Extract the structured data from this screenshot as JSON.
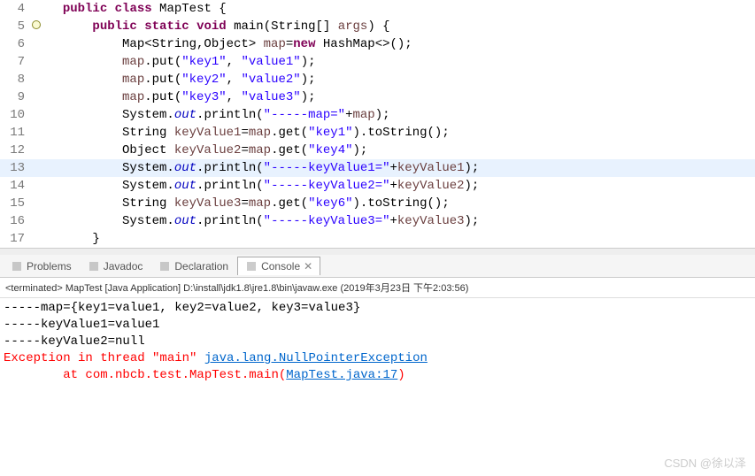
{
  "editor": {
    "lines": [
      {
        "num": 4,
        "marker": "",
        "highlight": false,
        "tokens": [
          {
            "cls": "norm",
            "t": "  "
          },
          {
            "cls": "kw",
            "t": "public"
          },
          {
            "cls": "norm",
            "t": " "
          },
          {
            "cls": "kw",
            "t": "class"
          },
          {
            "cls": "norm",
            "t": " MapTest {"
          }
        ]
      },
      {
        "num": 5,
        "marker": "circ",
        "highlight": false,
        "tokens": [
          {
            "cls": "norm",
            "t": "      "
          },
          {
            "cls": "kw",
            "t": "public"
          },
          {
            "cls": "norm",
            "t": " "
          },
          {
            "cls": "kw",
            "t": "static"
          },
          {
            "cls": "norm",
            "t": " "
          },
          {
            "cls": "kw",
            "t": "void"
          },
          {
            "cls": "norm",
            "t": " main(String[] "
          },
          {
            "cls": "var",
            "t": "args"
          },
          {
            "cls": "norm",
            "t": ") {"
          }
        ]
      },
      {
        "num": 6,
        "marker": "",
        "highlight": false,
        "tokens": [
          {
            "cls": "norm",
            "t": "          Map<String,Object> "
          },
          {
            "cls": "var",
            "t": "map"
          },
          {
            "cls": "norm",
            "t": "="
          },
          {
            "cls": "kw",
            "t": "new"
          },
          {
            "cls": "norm",
            "t": " HashMap<>();"
          }
        ]
      },
      {
        "num": 7,
        "marker": "",
        "highlight": false,
        "tokens": [
          {
            "cls": "norm",
            "t": "          "
          },
          {
            "cls": "var",
            "t": "map"
          },
          {
            "cls": "norm",
            "t": ".put("
          },
          {
            "cls": "str",
            "t": "\"key1\""
          },
          {
            "cls": "norm",
            "t": ", "
          },
          {
            "cls": "str",
            "t": "\"value1\""
          },
          {
            "cls": "norm",
            "t": ");"
          }
        ]
      },
      {
        "num": 8,
        "marker": "",
        "highlight": false,
        "tokens": [
          {
            "cls": "norm",
            "t": "          "
          },
          {
            "cls": "var",
            "t": "map"
          },
          {
            "cls": "norm",
            "t": ".put("
          },
          {
            "cls": "str",
            "t": "\"key2\""
          },
          {
            "cls": "norm",
            "t": ", "
          },
          {
            "cls": "str",
            "t": "\"value2\""
          },
          {
            "cls": "norm",
            "t": ");"
          }
        ]
      },
      {
        "num": 9,
        "marker": "",
        "highlight": false,
        "tokens": [
          {
            "cls": "norm",
            "t": "          "
          },
          {
            "cls": "var",
            "t": "map"
          },
          {
            "cls": "norm",
            "t": ".put("
          },
          {
            "cls": "str",
            "t": "\"key3\""
          },
          {
            "cls": "norm",
            "t": ", "
          },
          {
            "cls": "str",
            "t": "\"value3\""
          },
          {
            "cls": "norm",
            "t": ");"
          }
        ]
      },
      {
        "num": 10,
        "marker": "",
        "highlight": false,
        "tokens": [
          {
            "cls": "norm",
            "t": "          System."
          },
          {
            "cls": "field",
            "t": "out"
          },
          {
            "cls": "norm",
            "t": ".println("
          },
          {
            "cls": "str",
            "t": "\"-----map=\""
          },
          {
            "cls": "norm",
            "t": "+"
          },
          {
            "cls": "var",
            "t": "map"
          },
          {
            "cls": "norm",
            "t": ");"
          }
        ]
      },
      {
        "num": 11,
        "marker": "",
        "highlight": false,
        "tokens": [
          {
            "cls": "norm",
            "t": "          String "
          },
          {
            "cls": "var",
            "t": "keyValue1"
          },
          {
            "cls": "norm",
            "t": "="
          },
          {
            "cls": "var",
            "t": "map"
          },
          {
            "cls": "norm",
            "t": ".get("
          },
          {
            "cls": "str",
            "t": "\"key1\""
          },
          {
            "cls": "norm",
            "t": ").toString();"
          }
        ]
      },
      {
        "num": 12,
        "marker": "",
        "highlight": false,
        "tokens": [
          {
            "cls": "norm",
            "t": "          Object "
          },
          {
            "cls": "var",
            "t": "keyValue2"
          },
          {
            "cls": "norm",
            "t": "="
          },
          {
            "cls": "var",
            "t": "map"
          },
          {
            "cls": "norm",
            "t": ".get("
          },
          {
            "cls": "str",
            "t": "\"key4\""
          },
          {
            "cls": "norm",
            "t": ");"
          }
        ]
      },
      {
        "num": 13,
        "marker": "",
        "highlight": true,
        "tokens": [
          {
            "cls": "norm",
            "t": "          System."
          },
          {
            "cls": "field",
            "t": "out"
          },
          {
            "cls": "norm",
            "t": ".println("
          },
          {
            "cls": "str",
            "t": "\"-----keyValue1=\""
          },
          {
            "cls": "norm",
            "t": "+"
          },
          {
            "cls": "var",
            "t": "keyValue1"
          },
          {
            "cls": "norm",
            "t": ");"
          }
        ]
      },
      {
        "num": 14,
        "marker": "",
        "highlight": false,
        "tokens": [
          {
            "cls": "norm",
            "t": "          System."
          },
          {
            "cls": "field",
            "t": "out"
          },
          {
            "cls": "norm",
            "t": ".println("
          },
          {
            "cls": "str",
            "t": "\"-----keyValue2=\""
          },
          {
            "cls": "norm",
            "t": "+"
          },
          {
            "cls": "var",
            "t": "keyValue2"
          },
          {
            "cls": "norm",
            "t": ");"
          }
        ]
      },
      {
        "num": 15,
        "marker": "",
        "highlight": false,
        "tokens": [
          {
            "cls": "norm",
            "t": "          String "
          },
          {
            "cls": "var",
            "t": "keyValue3"
          },
          {
            "cls": "norm",
            "t": "="
          },
          {
            "cls": "var",
            "t": "map"
          },
          {
            "cls": "norm",
            "t": ".get("
          },
          {
            "cls": "str",
            "t": "\"key6\""
          },
          {
            "cls": "norm",
            "t": ").toString();"
          }
        ]
      },
      {
        "num": 16,
        "marker": "",
        "highlight": false,
        "tokens": [
          {
            "cls": "norm",
            "t": "          System."
          },
          {
            "cls": "field",
            "t": "out"
          },
          {
            "cls": "norm",
            "t": ".println("
          },
          {
            "cls": "str",
            "t": "\"-----keyValue3=\""
          },
          {
            "cls": "norm",
            "t": "+"
          },
          {
            "cls": "var",
            "t": "keyValue3"
          },
          {
            "cls": "norm",
            "t": ");"
          }
        ]
      },
      {
        "num": 17,
        "marker": "",
        "highlight": false,
        "tokens": [
          {
            "cls": "norm",
            "t": "      }"
          }
        ]
      }
    ]
  },
  "tabs": {
    "items": [
      {
        "label": "Problems",
        "active": false,
        "icon": "problems-icon"
      },
      {
        "label": "Javadoc",
        "active": false,
        "icon": "javadoc-icon"
      },
      {
        "label": "Declaration",
        "active": false,
        "icon": "declaration-icon"
      },
      {
        "label": "Console",
        "active": true,
        "icon": "console-icon"
      }
    ]
  },
  "console": {
    "header": "<terminated> MapTest [Java Application] D:\\install\\jdk1.8\\jre1.8\\bin\\javaw.exe (2019年3月23日 下午2:03:56)",
    "lines": [
      {
        "parts": [
          {
            "cls": "cline",
            "t": "-----map={key1=value1, key2=value2, key3=value3}"
          }
        ]
      },
      {
        "parts": [
          {
            "cls": "cline",
            "t": "-----keyValue1=value1"
          }
        ]
      },
      {
        "parts": [
          {
            "cls": "cline",
            "t": "-----keyValue2=null"
          }
        ]
      },
      {
        "parts": [
          {
            "cls": "cerr",
            "t": "Exception in thread \"main\" "
          },
          {
            "cls": "clink",
            "t": "java.lang.NullPointerException"
          }
        ]
      },
      {
        "parts": [
          {
            "cls": "cerr",
            "t": "        at com.nbcb.test.MapTest.main("
          },
          {
            "cls": "clink",
            "t": "MapTest.java:17"
          },
          {
            "cls": "cerr",
            "t": ")"
          }
        ]
      }
    ]
  },
  "watermark": "CSDN @徐以泽"
}
